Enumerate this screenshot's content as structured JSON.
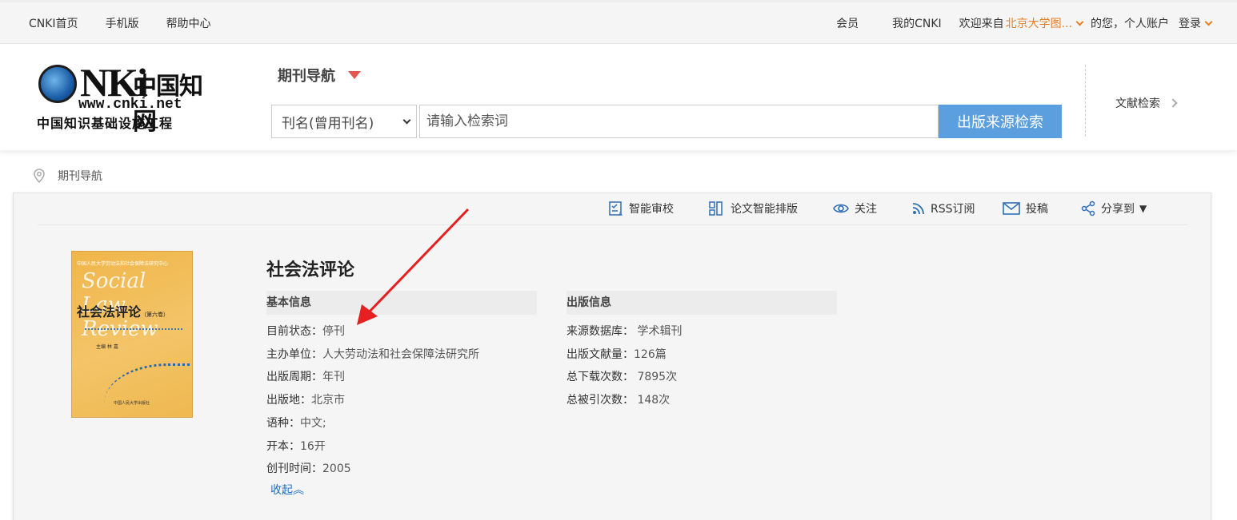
{
  "topbar": {
    "left_links": [
      "CNKI首页",
      "手机版",
      "帮助中心"
    ],
    "member": "会员",
    "my_cnki": "我的CNKI",
    "welcome": "欢迎来自",
    "institution": "北京大学图...",
    "suffix": "的您，个人账户",
    "login": "登录"
  },
  "logo": {
    "text_main": "NKi",
    "text_cn": "中国知网",
    "url": "www.cnki.net",
    "subtitle": "中国知识基础设施工程"
  },
  "header": {
    "nav_title": "期刊导航",
    "search": {
      "field_selected": "刊名(曾用刊名)",
      "placeholder": "请输入检索词",
      "button": "出版来源检索"
    },
    "literature_search": "文献检索"
  },
  "breadcrumb": "期刊导航",
  "toolbar": {
    "items": [
      {
        "label": "智能审校",
        "icon": "proofread-icon"
      },
      {
        "label": "论文智能排版",
        "icon": "layout-icon"
      },
      {
        "label": "关注",
        "icon": "eye-icon"
      },
      {
        "label": "RSS订阅",
        "icon": "rss-icon"
      },
      {
        "label": "投稿",
        "icon": "mail-icon"
      },
      {
        "label": "分享到",
        "icon": "share-icon"
      }
    ]
  },
  "cover": {
    "series": "中国人民大学劳动法和社会保障法研究中心",
    "script_text": "Social Law Review",
    "title": "社会法评论",
    "volume": "（第六卷）",
    "author": "主编  林  嘉",
    "publisher": "中国人民大学出版社"
  },
  "journal": {
    "title": "社会法评论",
    "basic_header": "基本信息",
    "publish_header": "出版信息",
    "basic_info": [
      {
        "key": "目前状态：",
        "value": "停刊"
      },
      {
        "key": "主办单位：",
        "value": "人大劳动法和社会保障法研究所"
      },
      {
        "key": "出版周期：",
        "value": "年刊"
      },
      {
        "key": "出版地：",
        "value": "北京市"
      },
      {
        "key": "语种：",
        "value": "中文;"
      },
      {
        "key": "开本：",
        "value": "16开"
      },
      {
        "key": "创刊时间：",
        "value": "2005"
      }
    ],
    "publish_info": [
      {
        "key": "来源数据库：",
        "value": " 学术辑刊"
      },
      {
        "key": "出版文献量：",
        "value": "126篇"
      },
      {
        "key": "总下载次数：",
        "value": " 7895次"
      },
      {
        "key": "总被引次数：",
        "value": " 148次"
      }
    ],
    "collapse": "收起︽"
  },
  "colors": {
    "accent": "#5b9fde",
    "institution": "#e77e23",
    "annotation_arrow": "#e62020",
    "link": "#1f6fc5"
  }
}
